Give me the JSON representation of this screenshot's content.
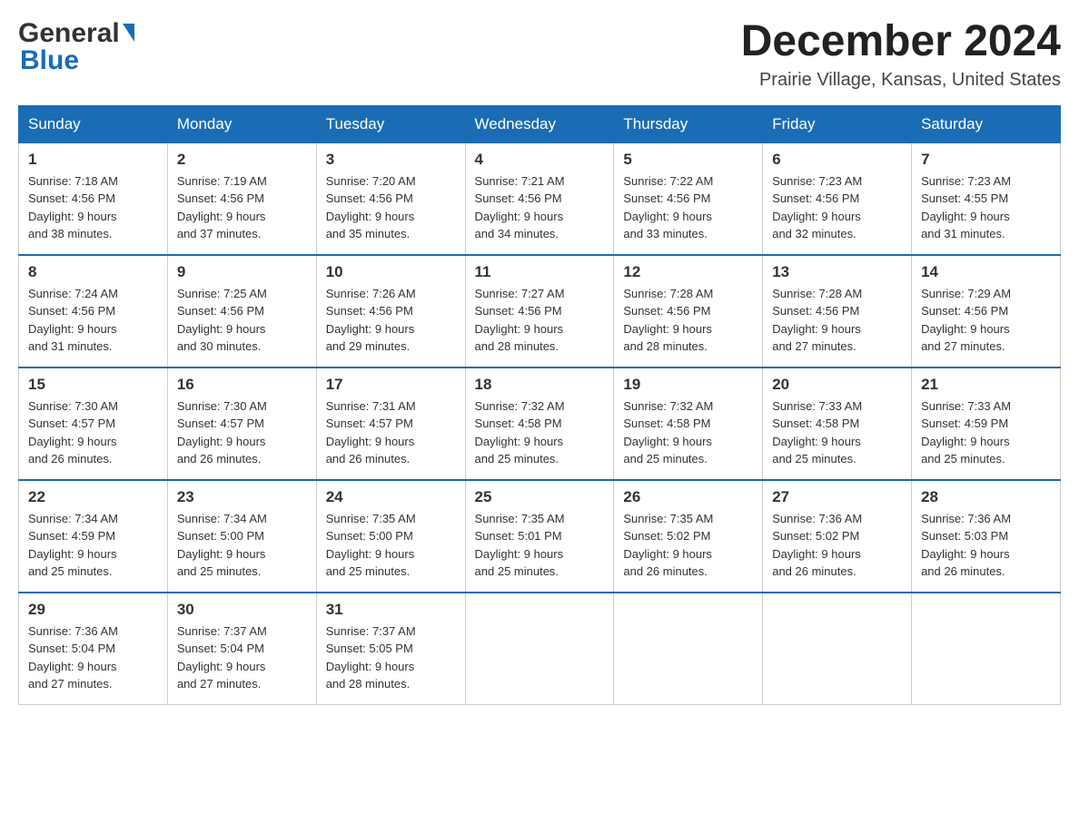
{
  "header": {
    "month_year": "December 2024",
    "location": "Prairie Village, Kansas, United States",
    "logo_general": "General",
    "logo_blue": "Blue"
  },
  "weekdays": [
    "Sunday",
    "Monday",
    "Tuesday",
    "Wednesday",
    "Thursday",
    "Friday",
    "Saturday"
  ],
  "weeks": [
    [
      {
        "day": "1",
        "sunrise": "7:18 AM",
        "sunset": "4:56 PM",
        "daylight": "9 hours and 38 minutes."
      },
      {
        "day": "2",
        "sunrise": "7:19 AM",
        "sunset": "4:56 PM",
        "daylight": "9 hours and 37 minutes."
      },
      {
        "day": "3",
        "sunrise": "7:20 AM",
        "sunset": "4:56 PM",
        "daylight": "9 hours and 35 minutes."
      },
      {
        "day": "4",
        "sunrise": "7:21 AM",
        "sunset": "4:56 PM",
        "daylight": "9 hours and 34 minutes."
      },
      {
        "day": "5",
        "sunrise": "7:22 AM",
        "sunset": "4:56 PM",
        "daylight": "9 hours and 33 minutes."
      },
      {
        "day": "6",
        "sunrise": "7:23 AM",
        "sunset": "4:56 PM",
        "daylight": "9 hours and 32 minutes."
      },
      {
        "day": "7",
        "sunrise": "7:23 AM",
        "sunset": "4:55 PM",
        "daylight": "9 hours and 31 minutes."
      }
    ],
    [
      {
        "day": "8",
        "sunrise": "7:24 AM",
        "sunset": "4:56 PM",
        "daylight": "9 hours and 31 minutes."
      },
      {
        "day": "9",
        "sunrise": "7:25 AM",
        "sunset": "4:56 PM",
        "daylight": "9 hours and 30 minutes."
      },
      {
        "day": "10",
        "sunrise": "7:26 AM",
        "sunset": "4:56 PM",
        "daylight": "9 hours and 29 minutes."
      },
      {
        "day": "11",
        "sunrise": "7:27 AM",
        "sunset": "4:56 PM",
        "daylight": "9 hours and 28 minutes."
      },
      {
        "day": "12",
        "sunrise": "7:28 AM",
        "sunset": "4:56 PM",
        "daylight": "9 hours and 28 minutes."
      },
      {
        "day": "13",
        "sunrise": "7:28 AM",
        "sunset": "4:56 PM",
        "daylight": "9 hours and 27 minutes."
      },
      {
        "day": "14",
        "sunrise": "7:29 AM",
        "sunset": "4:56 PM",
        "daylight": "9 hours and 27 minutes."
      }
    ],
    [
      {
        "day": "15",
        "sunrise": "7:30 AM",
        "sunset": "4:57 PM",
        "daylight": "9 hours and 26 minutes."
      },
      {
        "day": "16",
        "sunrise": "7:30 AM",
        "sunset": "4:57 PM",
        "daylight": "9 hours and 26 minutes."
      },
      {
        "day": "17",
        "sunrise": "7:31 AM",
        "sunset": "4:57 PM",
        "daylight": "9 hours and 26 minutes."
      },
      {
        "day": "18",
        "sunrise": "7:32 AM",
        "sunset": "4:58 PM",
        "daylight": "9 hours and 25 minutes."
      },
      {
        "day": "19",
        "sunrise": "7:32 AM",
        "sunset": "4:58 PM",
        "daylight": "9 hours and 25 minutes."
      },
      {
        "day": "20",
        "sunrise": "7:33 AM",
        "sunset": "4:58 PM",
        "daylight": "9 hours and 25 minutes."
      },
      {
        "day": "21",
        "sunrise": "7:33 AM",
        "sunset": "4:59 PM",
        "daylight": "9 hours and 25 minutes."
      }
    ],
    [
      {
        "day": "22",
        "sunrise": "7:34 AM",
        "sunset": "4:59 PM",
        "daylight": "9 hours and 25 minutes."
      },
      {
        "day": "23",
        "sunrise": "7:34 AM",
        "sunset": "5:00 PM",
        "daylight": "9 hours and 25 minutes."
      },
      {
        "day": "24",
        "sunrise": "7:35 AM",
        "sunset": "5:00 PM",
        "daylight": "9 hours and 25 minutes."
      },
      {
        "day": "25",
        "sunrise": "7:35 AM",
        "sunset": "5:01 PM",
        "daylight": "9 hours and 25 minutes."
      },
      {
        "day": "26",
        "sunrise": "7:35 AM",
        "sunset": "5:02 PM",
        "daylight": "9 hours and 26 minutes."
      },
      {
        "day": "27",
        "sunrise": "7:36 AM",
        "sunset": "5:02 PM",
        "daylight": "9 hours and 26 minutes."
      },
      {
        "day": "28",
        "sunrise": "7:36 AM",
        "sunset": "5:03 PM",
        "daylight": "9 hours and 26 minutes."
      }
    ],
    [
      {
        "day": "29",
        "sunrise": "7:36 AM",
        "sunset": "5:04 PM",
        "daylight": "9 hours and 27 minutes."
      },
      {
        "day": "30",
        "sunrise": "7:37 AM",
        "sunset": "5:04 PM",
        "daylight": "9 hours and 27 minutes."
      },
      {
        "day": "31",
        "sunrise": "7:37 AM",
        "sunset": "5:05 PM",
        "daylight": "9 hours and 28 minutes."
      },
      null,
      null,
      null,
      null
    ]
  ],
  "labels": {
    "sunrise_prefix": "Sunrise: ",
    "sunset_prefix": "Sunset: ",
    "daylight_prefix": "Daylight: "
  }
}
